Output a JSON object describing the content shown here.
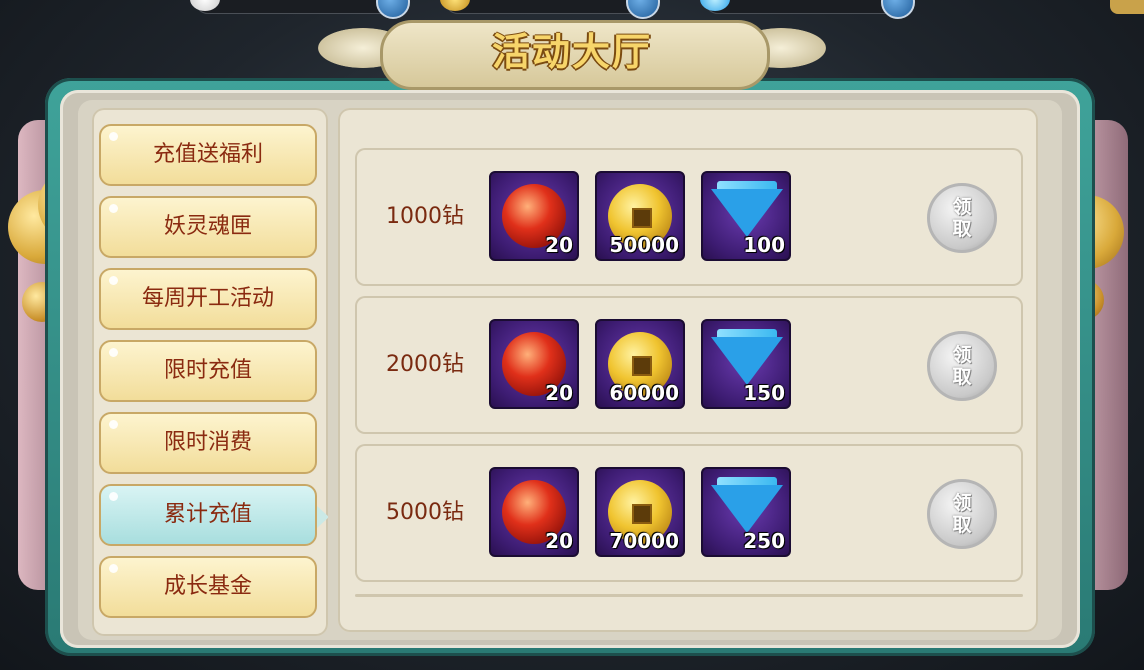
{
  "title": "活动大厅",
  "resources": [
    {
      "icon": "spirit-orb-icon",
      "value": ""
    },
    {
      "icon": "gold-coin-icon",
      "value": ""
    },
    {
      "icon": "diamond-icon",
      "value": ""
    }
  ],
  "menu": {
    "items": [
      {
        "label": "充值送福利"
      },
      {
        "label": "妖灵魂匣"
      },
      {
        "label": "每周开工活动"
      },
      {
        "label": "限时充值"
      },
      {
        "label": "限时消费"
      },
      {
        "label": "累计充值"
      },
      {
        "label": "成长基金"
      }
    ],
    "active_index": 5
  },
  "tiers": [
    {
      "label": "1000钻",
      "rewards": [
        {
          "icon": "red-orb-icon",
          "count": "20"
        },
        {
          "icon": "gold-coin-icon",
          "count": "50000"
        },
        {
          "icon": "diamond-icon",
          "count": "100"
        }
      ],
      "claim": "领取"
    },
    {
      "label": "2000钻",
      "rewards": [
        {
          "icon": "red-orb-icon",
          "count": "20"
        },
        {
          "icon": "gold-coin-icon",
          "count": "60000"
        },
        {
          "icon": "diamond-icon",
          "count": "150"
        }
      ],
      "claim": "领取"
    },
    {
      "label": "5000钻",
      "rewards": [
        {
          "icon": "red-orb-icon",
          "count": "20"
        },
        {
          "icon": "gold-coin-icon",
          "count": "70000"
        },
        {
          "icon": "diamond-icon",
          "count": "250"
        }
      ],
      "claim": "领取"
    }
  ],
  "colors": {
    "frame": "#3fa39a",
    "menu_text": "#8a2a10",
    "active_tab": "#a8dede",
    "slot_bg": "#3d1c72"
  }
}
